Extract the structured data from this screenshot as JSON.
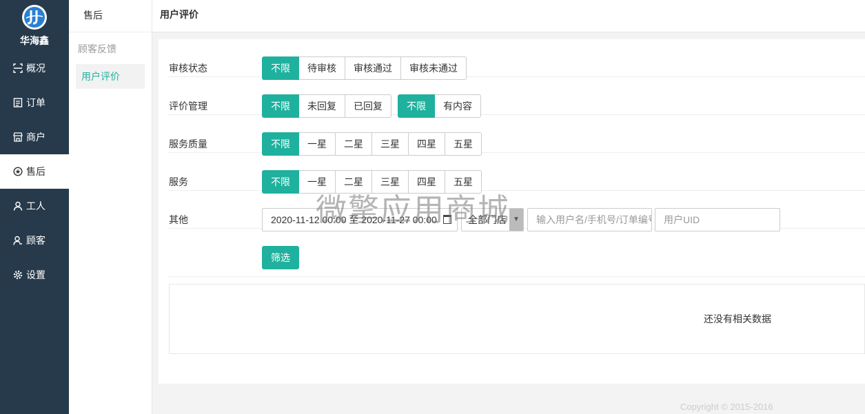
{
  "brand": {
    "name": "华海鑫",
    "logo_icon": "jj-logo-icon"
  },
  "nav": [
    {
      "label": "概况",
      "icon": "overview-icon",
      "active": false
    },
    {
      "label": "订单",
      "icon": "order-icon",
      "active": false
    },
    {
      "label": "商户",
      "icon": "store-icon",
      "active": false
    },
    {
      "label": "售后",
      "icon": "aftersale-icon",
      "active": true
    },
    {
      "label": "工人",
      "icon": "worker-icon",
      "active": false
    },
    {
      "label": "顾客",
      "icon": "customer-icon",
      "active": false
    },
    {
      "label": "设置",
      "icon": "gear-icon",
      "active": false
    }
  ],
  "submenu": {
    "title": "售后",
    "group": "顾客反馈",
    "item": "用户评价"
  },
  "header": {
    "title": "用户评价"
  },
  "filters": {
    "review_status": {
      "label": "审核状态",
      "options": [
        "不限",
        "待审核",
        "审核通过",
        "审核未通过"
      ],
      "selected": 0
    },
    "review_manage": {
      "label": "评价管理",
      "options_a": [
        "不限",
        "未回复",
        "已回复"
      ],
      "options_b": [
        "不限",
        "有内容"
      ]
    },
    "service_quality": {
      "label": "服务质量",
      "options": [
        "不限",
        "一星",
        "二星",
        "三星",
        "四星",
        "五星"
      ]
    },
    "service": {
      "label": "服务",
      "options": [
        "不限",
        "一星",
        "二星",
        "三星",
        "四星",
        "五星"
      ]
    },
    "other": {
      "label": "其他",
      "date_range": "2020-11-12 00:00 至 2020-11-27 00:00",
      "store_select": "全部门店",
      "keyword_placeholder": "输入用户名/手机号/订单编号",
      "uid_placeholder": "用户UID"
    },
    "submit_label": "筛选"
  },
  "empty_text": "还没有相关数据",
  "footer": "Copyright © 2015-2016",
  "watermark": "微擎应用商城",
  "colors": {
    "accent": "#1fb19e",
    "sidebar": "#273a4b"
  }
}
